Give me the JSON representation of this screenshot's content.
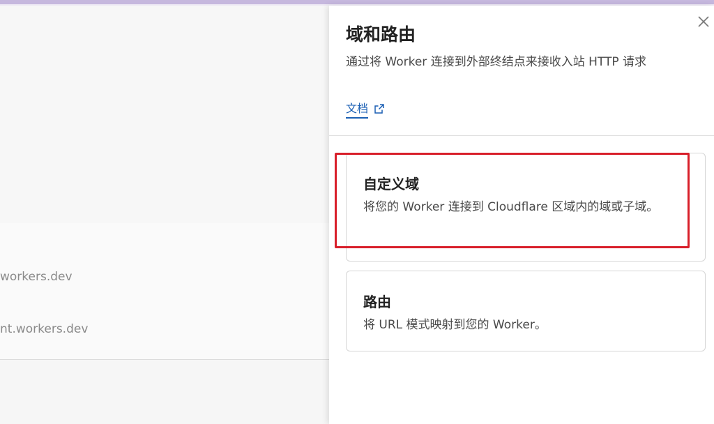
{
  "background": {
    "rows": [
      {
        "text": ""
      },
      {
        "text": ""
      },
      {
        "text": ""
      },
      {
        "text": "workers.dev"
      },
      {
        "text": "nt.workers.dev"
      }
    ]
  },
  "drawer": {
    "title": "域和路由",
    "description": "通过将 Worker 连接到外部终结点来接收入站 HTTP 请求",
    "docs_label": "文档",
    "options": [
      {
        "title": "自定义域",
        "description": "将您的 Worker 连接到 Cloudflare 区域内的域或子域。"
      },
      {
        "title": "路由",
        "description": "将 URL 模式映射到您的 Worker。"
      }
    ]
  },
  "colors": {
    "link": "#1a5fb4",
    "highlight": "#d81f2a",
    "top_strip": "#c6b8de"
  },
  "icons": {
    "close": "close-icon",
    "external_link": "external-link-icon"
  }
}
